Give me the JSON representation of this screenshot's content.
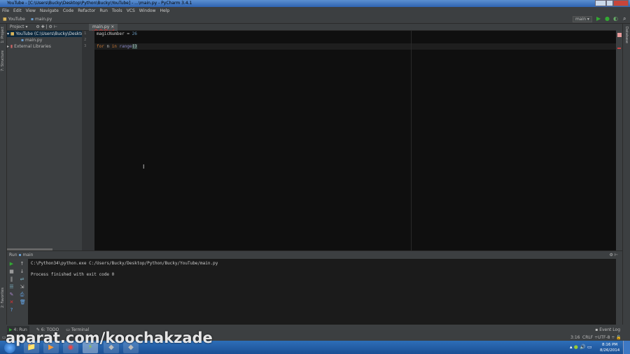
{
  "window": {
    "title": "YouTube - [C:\\Users\\Bucky\\Desktop\\Python\\Bucky\\YouTube] - ...\\main.py - PyCharm 3.4.1"
  },
  "menu": [
    "File",
    "Edit",
    "View",
    "Navigate",
    "Code",
    "Refactor",
    "Run",
    "Tools",
    "VCS",
    "Window",
    "Help"
  ],
  "nav": {
    "project": "YouTube",
    "file": "main.py",
    "run_config": "main"
  },
  "project_panel": {
    "title": "Project",
    "root": "YouTube",
    "root_path": "(C:\\Users\\Bucky\\Desktop",
    "file": "main.py",
    "libs": "External Libraries"
  },
  "side": {
    "project": "1: Project",
    "structure": "7: Structure",
    "favorites": "2: Favorites",
    "database": "Database"
  },
  "editor": {
    "tab": "main.py",
    "lines": [
      "1",
      "2",
      "3"
    ],
    "l1_var": "magicNumber",
    "l1_op": " = ",
    "l1_num": "26",
    "l3_kw1": "for",
    "l3_var": " n ",
    "l3_kw2": "in",
    "l3_fn": " range",
    "l3_paren": "()"
  },
  "run": {
    "title": "Run",
    "config": "main",
    "cmd": "C:\\Python34\\python.exe C:/Users/Bucky/Desktop/Python/Bucky/YouTube/main.py",
    "result": "Process finished with exit code 0"
  },
  "bottom_tabs": [
    "4: Run",
    "6: TODO",
    "Terminal"
  ],
  "status": {
    "event_log": "Event Log",
    "position": "3:16",
    "line_sep": "CRLF",
    "encoding": "UTF-8"
  },
  "taskbar": {
    "time": "8:16 PM",
    "date": "8/26/2014"
  },
  "watermark": "aparat.com/koochakzade"
}
